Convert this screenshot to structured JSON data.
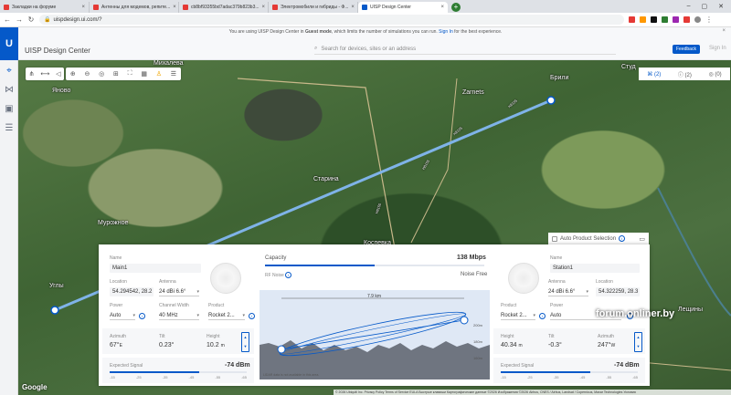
{
  "browser": {
    "tabs": [
      {
        "label": "Закладки на форуме",
        "color": "#e53935",
        "active": false
      },
      {
        "label": "Антенны для модемов, репите...",
        "color": "#e53935",
        "active": false
      },
      {
        "label": "cb8bf93355bd7adac379b823b3...",
        "color": "#e53935",
        "active": false
      },
      {
        "label": "Электромобили и гибриды - Ф...",
        "color": "#e53935",
        "active": false
      },
      {
        "label": "UISP Design Center",
        "color": "#0559c9",
        "active": true
      }
    ],
    "new_tab": "+",
    "url": "uispdesign.ui.com/?"
  },
  "app": {
    "title": "UISP Design Center",
    "guest_pre": "You are using UISP Design Center in ",
    "guest_mode": "Guest mode",
    "guest_mid": ", which limits the number of simulations you can run. ",
    "guest_signin": "Sign In",
    "guest_post": " for the best experience.",
    "search_placeholder": "Search for devices, sites or an address",
    "feedback": "Feedback",
    "signin": "Sign In",
    "counters": [
      "(2)",
      "(2)",
      "(0)"
    ]
  },
  "map": {
    "labels": [
      "Михалева",
      "Яново",
      "Zarnets",
      "Брили",
      "Студ",
      "Старина",
      "Мурожное",
      "Коспевка",
      "Углы",
      "Лещины"
    ],
    "road_labels": [
      "H8155",
      "H8155",
      "H8155",
      "H8155"
    ],
    "google": "Google",
    "attribution": "© 2026 Ubiquiti Inc.   Privacy Policy   Terms of Service   EULA   Быстрые клавиши   Картографические данные ©2026 Изображения ©2026 Airbus, CNES / Airbus, Landsat / Copernicus, Maxar Technologies   Условия",
    "watermark": "forum.onliner.by"
  },
  "panel": {
    "left": {
      "name_label": "Name",
      "name": "Main1",
      "location_label": "Location",
      "location": "54.294542, 28.2",
      "antenna_label": "Antenna",
      "antenna": "24 dBi 6.6°",
      "power_label": "Power",
      "power": "Auto",
      "channel_label": "Channel Width",
      "channel": "40 MHz",
      "product_label": "Product",
      "product": "Rocket 2...",
      "azimuth_label": "Azimuth",
      "azimuth": "67°",
      "azimuth_unit": "E",
      "tilt_label": "Tilt",
      "tilt": "0.23°",
      "height_label": "Height",
      "height": "10.2",
      "height_unit": "m",
      "signal_label": "Expected Signal",
      "signal": "-74 dBm",
      "signal_fraction": 0.65,
      "scale": [
        "-15",
        "-25",
        "-35",
        "-45",
        "-55",
        "-65"
      ]
    },
    "center": {
      "capacity_label": "Capacity",
      "capacity": "138 Mbps",
      "capacity_fraction": 0.5,
      "rf_label": "RF Noise",
      "noise": "Noise Free",
      "distance": "7.9 km",
      "axis_labels": [
        "200m",
        "180m",
        "160m"
      ],
      "note": "LIDAR data is not available in this area."
    },
    "right": {
      "auto_select": "Auto Product Selection",
      "name_label": "Name",
      "name": "Station1",
      "antenna_label": "Antenna",
      "antenna": "24 dBi 6.6°",
      "location_label": "Location",
      "location": "54.322259, 28.3",
      "product_label": "Product",
      "product": "Rocket 2...",
      "power_label": "Power",
      "power": "Auto",
      "height_label": "Height",
      "height": "40.34",
      "height_unit": "m",
      "tilt_label": "Tilt",
      "tilt": "-0.3°",
      "azimuth_label": "Azimuth",
      "azimuth": "247°",
      "azimuth_unit": "W",
      "signal_label": "Expected Signal",
      "signal": "-74 dBm",
      "signal_fraction": 0.65,
      "scale": [
        "-15",
        "-25",
        "-35",
        "-45",
        "-55",
        "-65"
      ]
    }
  },
  "colors": {
    "accent": "#0559c9",
    "link_line": "#7fb3e8"
  }
}
